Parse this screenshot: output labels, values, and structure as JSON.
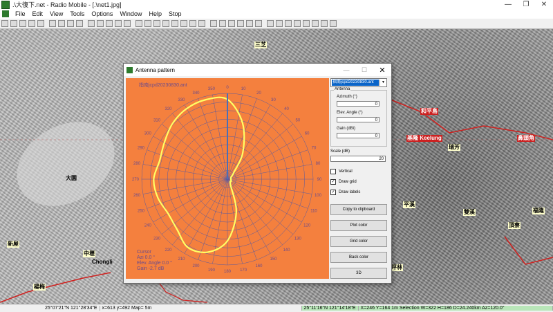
{
  "window": {
    "title": ".\\大復下.net - Radio Mobile - [.\\net1.jpg]",
    "min": "—",
    "max": "❐",
    "close": "✕"
  },
  "menu": [
    "File",
    "Edit",
    "View",
    "Tools",
    "Options",
    "Window",
    "Help",
    "Stop"
  ],
  "map": {
    "labels": [
      {
        "text": "三芝"
      },
      {
        "text": "和平島"
      },
      {
        "text": "基隆 Keelung"
      },
      {
        "text": "鼻頭角"
      },
      {
        "text": "瑞芳"
      },
      {
        "text": "大園"
      },
      {
        "text": "新屋"
      },
      {
        "text": "中壢"
      },
      {
        "text": "Chongli"
      },
      {
        "text": "楊梅"
      },
      {
        "text": "平溪"
      },
      {
        "text": "雙溪"
      },
      {
        "text": "福隆"
      },
      {
        "text": "頂寮"
      },
      {
        "text": "坪林"
      }
    ]
  },
  "status": {
    "left_coord": "25°07'21\"N  121°28'34\"E",
    "left_xy": "x=613 y=492 Map= 5m",
    "right_coord": "25°11'16\"N  121°14'18\"E",
    "right_info": "X=246 Y=164 1m Selection W=322 H=186 D=24.240km Az=120.0°"
  },
  "dialog": {
    "title": "Antenna pattern",
    "min": "—",
    "max": "☐",
    "close": "✕",
    "file": "指南jcpd20230830.ant",
    "combo_value": "指南jcpd20230830.ant",
    "antenna_group": "Antenna",
    "azimuth_label": "Azimuth (°)",
    "azimuth_value": "0",
    "elev_label": "Elev. Angle (°)",
    "elev_value": "0",
    "gain_label": "Gain (dBi)",
    "gain_value": "0",
    "scale_label": "Scale (dB)",
    "scale_value": "20",
    "vertical_label": "Vertical",
    "vertical_checked": false,
    "draw_grid_label": "Draw grid",
    "draw_grid_checked": true,
    "draw_labels_label": "Draw labels",
    "draw_labels_checked": true,
    "buttons": {
      "copy": "Copy to clipboard",
      "plot_color": "Plot color",
      "grid_color": "Grid color",
      "back_color": "Back color",
      "three_d": "3D"
    },
    "cursor": {
      "heading": "Cursor",
      "az": "Azi 0.0 °",
      "elev": "Elev. Angle 0.0 °",
      "gain": "Gain -2.7 dB"
    },
    "colors": {
      "plot": "#ffff66",
      "grid": "#5a5aa0",
      "back": "#f4803e",
      "needle": "#4a6fb8"
    }
  },
  "chart_data": {
    "type": "polar",
    "angle_labels": [
      "0",
      "10",
      "20",
      "30",
      "40",
      "50",
      "60",
      "70",
      "80",
      "90",
      "100",
      "110",
      "120",
      "130",
      "140",
      "150",
      "160",
      "170",
      "180",
      "190",
      "200",
      "210",
      "220",
      "230",
      "240",
      "250",
      "260",
      "270",
      "280",
      "290",
      "300",
      "310",
      "320",
      "330",
      "340",
      "350"
    ],
    "rings": 10,
    "scale_db": 20,
    "pattern": [
      {
        "az": 0,
        "r": 0.93
      },
      {
        "az": 15,
        "r": 0.68
      },
      {
        "az": 30,
        "r": 0.36
      },
      {
        "az": 45,
        "r": 0.1
      },
      {
        "az": 60,
        "r": 0.05
      },
      {
        "az": 90,
        "r": 0.04
      },
      {
        "az": 120,
        "r": 0.05
      },
      {
        "az": 150,
        "r": 0.07
      },
      {
        "az": 165,
        "r": 0.4
      },
      {
        "az": 180,
        "r": 0.72
      },
      {
        "az": 195,
        "r": 0.88
      },
      {
        "az": 210,
        "r": 0.92
      },
      {
        "az": 225,
        "r": 0.83
      },
      {
        "az": 240,
        "r": 0.8
      },
      {
        "az": 255,
        "r": 0.84
      },
      {
        "az": 270,
        "r": 0.86
      },
      {
        "az": 285,
        "r": 0.82
      },
      {
        "az": 300,
        "r": 0.85
      },
      {
        "az": 315,
        "r": 0.91
      },
      {
        "az": 330,
        "r": 0.95
      },
      {
        "az": 345,
        "r": 0.96
      },
      {
        "az": 360,
        "r": 0.93
      }
    ]
  }
}
